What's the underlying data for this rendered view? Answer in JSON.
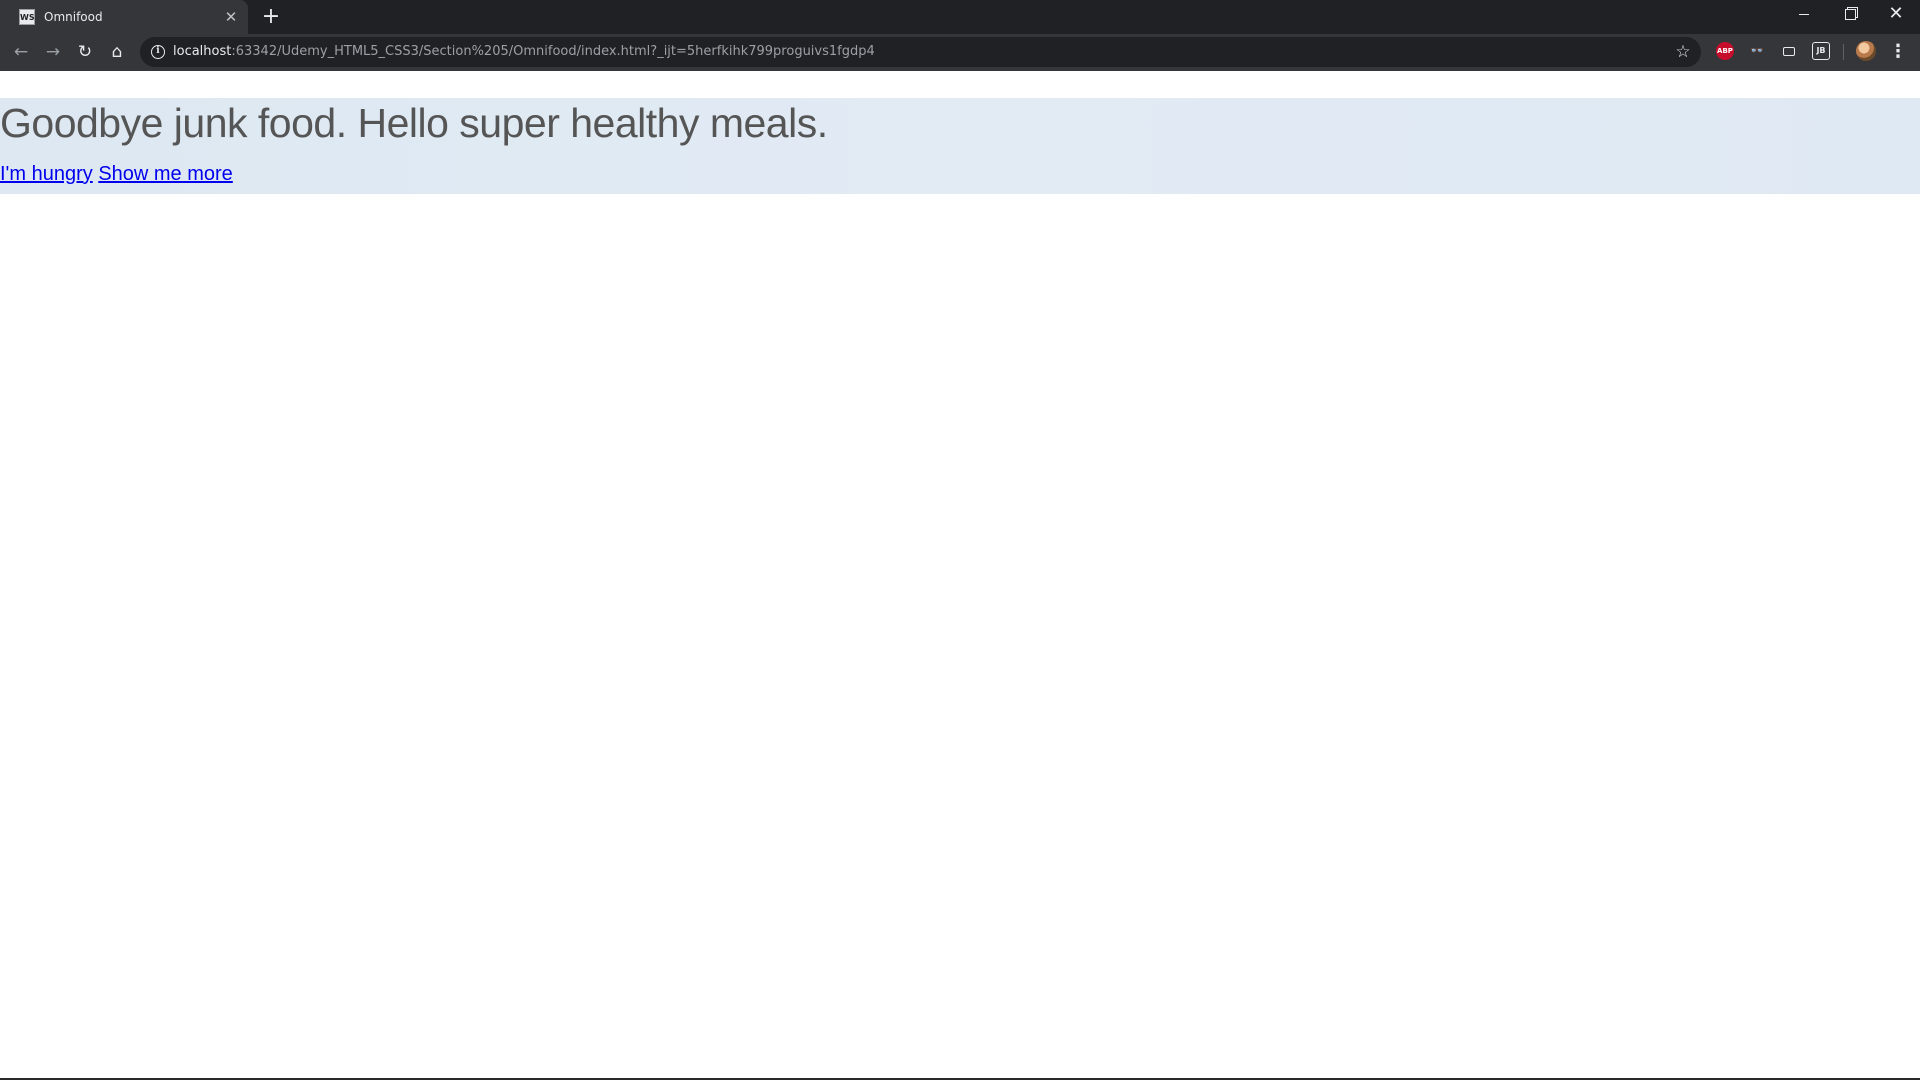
{
  "browser": {
    "tab": {
      "favicon_text": "WS",
      "title": "Omnifood",
      "close_glyph": "✕"
    },
    "new_tab_glyph": "+",
    "window_controls": {
      "minimize_icon": "minimize-icon",
      "restore_icon": "restore-icon",
      "close_glyph": "✕"
    },
    "nav": {
      "back_glyph": "←",
      "forward_glyph": "→",
      "reload_glyph": "↻",
      "home_glyph": "⌂"
    },
    "address_bar": {
      "info_glyph": "i",
      "url_host": "localhost",
      "url_rest": ":63342/Udemy_HTML5_CSS3/Section%205/Omnifood/index.html?_ijt=5herfkihk799proguivs1fgdp4"
    },
    "bookmark_glyph": "☆",
    "extensions": {
      "abp_label": "ABP",
      "spy_glyph": "👓",
      "jb_label": "JB"
    },
    "menu_glyph": "⋮"
  },
  "page": {
    "hero": {
      "title": "Goodbye junk food. Hello super healthy meals.",
      "link_hungry": "I'm hungry",
      "link_more": "Show me more"
    }
  },
  "colors": {
    "hero_background": "#dfe9f3",
    "title_text": "#555555",
    "link": "#0000ee",
    "tabstrip": "#202124",
    "toolbar": "#35363a"
  }
}
